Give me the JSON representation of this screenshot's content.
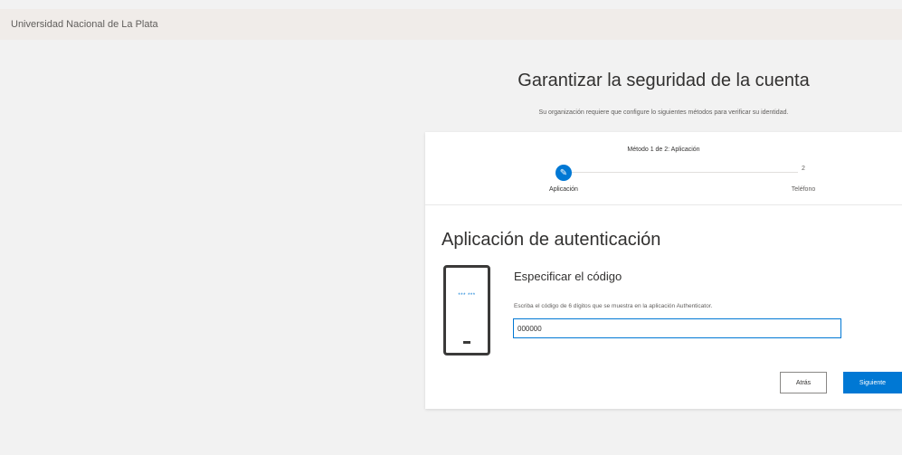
{
  "header": {
    "org_name": "Universidad Nacional de La Plata"
  },
  "page": {
    "title": "Garantizar la seguridad de la cuenta",
    "subtitle": "Su organización requiere que configure lo siguientes métodos para verificar su identidad."
  },
  "wizard": {
    "step_header": "Método 1 de 2: Aplicación",
    "steps": [
      {
        "label": "Aplicación",
        "status": "completed",
        "icon": "pencil-icon",
        "icon_glyph": "✎"
      },
      {
        "label": "Teléfono",
        "status": "pending",
        "number": "2"
      }
    ],
    "accent_color": "#0078d4"
  },
  "section": {
    "title": "Aplicación de autenticación",
    "phone_code_sample": "*** ***",
    "code_heading": "Especificar el código",
    "code_description": "Escriba el código de 6 dígitos que se muestra en la aplicación Authenticator.",
    "code_input": {
      "value": "000000",
      "placeholder": ""
    }
  },
  "buttons": {
    "back": "Atrás",
    "next": "Siguiente"
  }
}
